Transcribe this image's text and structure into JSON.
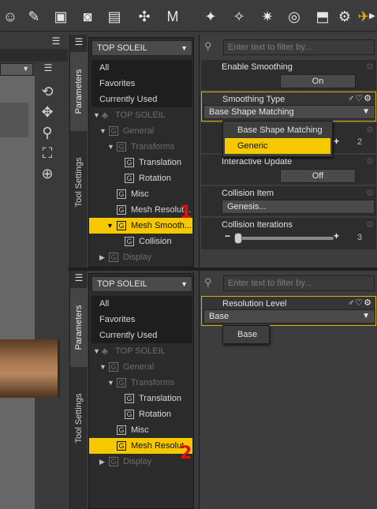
{
  "panel_top": {
    "node_selector": "TOP SOLEIL",
    "filter_placeholder": "Enter text to filter by...",
    "side_tabs": [
      "Parameters",
      "Tool Settings"
    ],
    "tree": {
      "all": "All",
      "favorites": "Favorites",
      "currently_used": "Currently Used",
      "root": "TOP SOLEIL",
      "general": "General",
      "transforms": "Transforms",
      "translation": "Translation",
      "rotation": "Rotation",
      "misc": "Misc",
      "mesh_resolution": "Mesh Resolut...",
      "mesh_smoothing": "Mesh Smooth...",
      "collision": "Collision",
      "display": "Display"
    },
    "properties": {
      "enable_smoothing": {
        "label": "Enable Smoothing",
        "value": "On"
      },
      "smoothing_type": {
        "label": "Smoothing Type",
        "value": "Base Shape Matching",
        "options": [
          "Base Shape Matching",
          "Generic"
        ],
        "highlighted": "Generic"
      },
      "smoothing_iterations": {
        "value": "2"
      },
      "interactive_update": {
        "label": "Interactive Update",
        "value": "Off"
      },
      "collision_item": {
        "label": "Collision Item",
        "value": "Genesis..."
      },
      "collision_iterations": {
        "label": "Collision Iterations",
        "value": "3"
      }
    }
  },
  "panel_bottom": {
    "node_selector": "TOP SOLEIL",
    "filter_placeholder": "Enter text to filter by...",
    "side_tabs": [
      "Parameters",
      "Tool Settings"
    ],
    "tree": {
      "all": "All",
      "favorites": "Favorites",
      "currently_used": "Currently Used",
      "root": "TOP SOLEIL",
      "general": "General",
      "transforms": "Transforms",
      "translation": "Translation",
      "rotation": "Rotation",
      "misc": "Misc",
      "mesh_resolution": "Mesh Resolut",
      "display": "Display"
    },
    "properties": {
      "resolution_level": {
        "label": "Resolution Level",
        "value": "Base",
        "options": [
          "Base"
        ]
      }
    }
  },
  "annotations": {
    "marker_1": "1",
    "marker_2": "2"
  },
  "colors": {
    "selection": "#f5c800",
    "annotation": "#e01010"
  },
  "icons": [
    "figure-icon",
    "pose-icon",
    "edit-scene-icon",
    "render-icon",
    "camera-icon",
    "texture-icon",
    "bone-icon",
    "morph-icon",
    "light-icon",
    "spotlight-icon",
    "point-light-icon",
    "distant-light-icon",
    "timer-icon",
    "node-icon",
    "settings-icon"
  ]
}
